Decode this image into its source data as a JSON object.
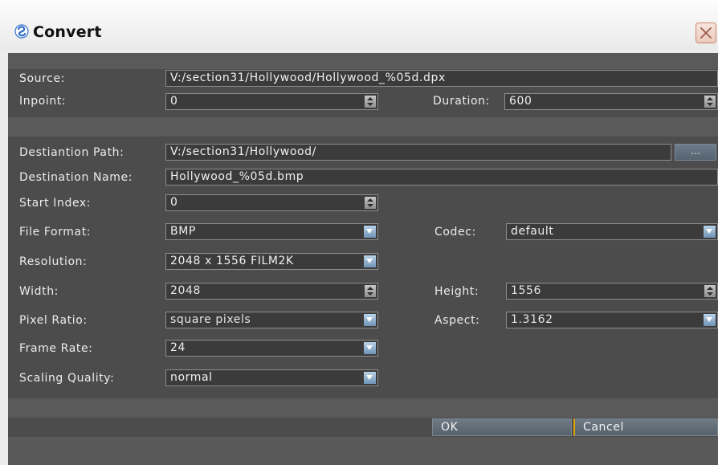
{
  "window": {
    "title": "Convert"
  },
  "icons": {
    "title": "app-swirl-icon",
    "close": "close-icon",
    "spin": "spin-arrows-icon",
    "dropdown": "chevron-down-icon"
  },
  "colors": {
    "panel": "#4c4c4c",
    "field_bg": "#3b3b3b",
    "button": "#5f6a75",
    "focus_accent": "#e0a800"
  },
  "source": {
    "label": "Source:",
    "value": "V:/section31/Hollywood/Hollywood_%05d.dpx",
    "inpoint_label": "Inpoint:",
    "inpoint_value": "0",
    "duration_label": "Duration:",
    "duration_value": "600"
  },
  "destination": {
    "path_label": "Destiantion Path:",
    "path_value": "V:/section31/Hollywood/",
    "browse_label": "...",
    "name_label": "Destination Name:",
    "name_value": "Hollywood_%05d.bmp",
    "start_index_label": "Start Index:",
    "start_index_value": "0",
    "file_format_label": "File Format:",
    "file_format_value": "BMP",
    "codec_label": "Codec:",
    "codec_value": "default",
    "resolution_label": "Resolution:",
    "resolution_value": "2048 x 1556 FILM2K",
    "width_label": "Width:",
    "width_value": "2048",
    "height_label": "Height:",
    "height_value": "1556",
    "pixel_ratio_label": "Pixel Ratio:",
    "pixel_ratio_value": "square pixels",
    "aspect_label": "Aspect:",
    "aspect_value": "1.3162",
    "frame_rate_label": "Frame Rate:",
    "frame_rate_value": "24",
    "scaling_label": "Scaling Quality:",
    "scaling_value": "normal"
  },
  "buttons": {
    "ok": "OK",
    "cancel": "Cancel"
  }
}
